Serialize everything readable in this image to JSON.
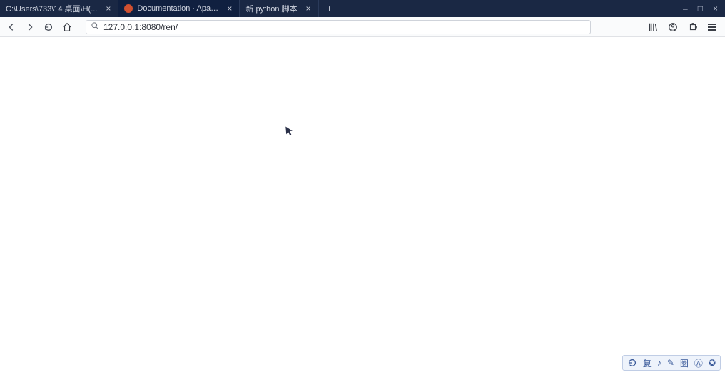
{
  "tabs": [
    {
      "label": "C:\\Users\\733\\14 桌面\\H(... ",
      "close": "×"
    },
    {
      "label": "Documentation · Apache E...",
      "close": "×"
    },
    {
      "label": "新 python 脚本",
      "close": "×"
    }
  ],
  "new_tab": "+",
  "window": {
    "min": "–",
    "max": "□",
    "close": "×"
  },
  "nav": {
    "back": "‹",
    "forward": "›",
    "reload": "⟳"
  },
  "url": {
    "value": "127.0.0.1:8080/ren/"
  },
  "toolbar_icons": {
    "library": "library-icon",
    "firefox_view": "view-icon",
    "extension": "extension-icon",
    "menu": "menu-icon"
  },
  "cursor_glyph": "↖",
  "ime": {
    "items": [
      "⟳",
      "复",
      "♪",
      "✎",
      "圈",
      "Ⓐ",
      "✪"
    ]
  }
}
